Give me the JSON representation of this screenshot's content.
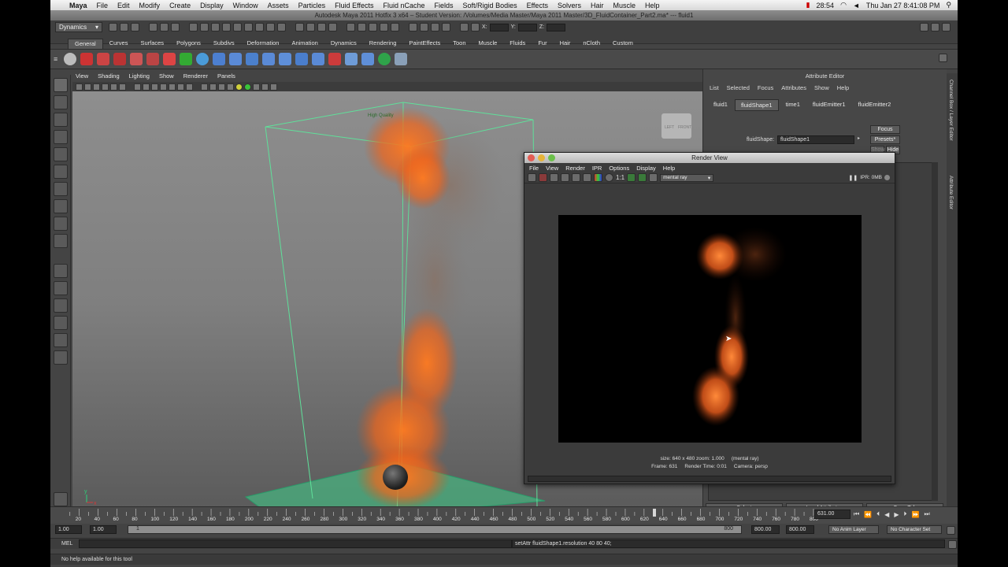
{
  "mac_menubar": {
    "items": [
      "Maya",
      "File",
      "Edit",
      "Modify",
      "Create",
      "Display",
      "Window",
      "Assets",
      "Particles",
      "Fluid Effects",
      "Fluid nCache",
      "Fields",
      "Soft/Rigid Bodies",
      "Effects",
      "Solvers",
      "Hair",
      "Muscle",
      "Help"
    ],
    "battery_time": "28:54",
    "clock": "Thu Jan 27  8:41:08 PM"
  },
  "window_title": "Autodesk Maya 2011 Hotfix 3 x64 – Student Version: /Volumes/Media Master/Maya 2011 Master/3D_FluidContainer_Part2.ma*  ---  fluid1",
  "status_line": {
    "menu_set": "Dynamics",
    "x_label": "X:",
    "y_label": "Y:",
    "z_label": "Z:"
  },
  "shelf_tabs": [
    "General",
    "Curves",
    "Surfaces",
    "Polygons",
    "Subdivs",
    "Deformation",
    "Animation",
    "Dynamics",
    "Rendering",
    "PaintEffects",
    "Toon",
    "Muscle",
    "Fluids",
    "Fur",
    "Hair",
    "nCloth",
    "Custom"
  ],
  "viewport": {
    "menu": [
      "View",
      "Shading",
      "Lighting",
      "Show",
      "Renderer",
      "Panels"
    ],
    "quality_label": "High Quality",
    "viewcube_left": "LEFT",
    "viewcube_front": "FRONT",
    "axis_y": "y",
    "axis_x": "x"
  },
  "attribute_editor": {
    "title": "Attribute Editor",
    "menu": [
      "List",
      "Selected",
      "Focus",
      "Attributes",
      "Show",
      "Help"
    ],
    "tabs": [
      "fluid1",
      "fluidShape1",
      "time1",
      "fluidEmitter1",
      "fluidEmitter2"
    ],
    "shape_label": "fluidShape:",
    "shape_value": "fluidShape1",
    "focus_btn": "Focus",
    "presets_btn": "Presets*",
    "show_btn": "Show",
    "hide_btn": "Hide",
    "bottom_buttons": [
      "Select",
      "Load Attributes",
      "Copy Tab"
    ],
    "side_tab_1": "Channel Box / Layer Editor",
    "side_tab_2": "Attribute Editor"
  },
  "render_view": {
    "title": "Render View",
    "menu": [
      "File",
      "View",
      "Render",
      "IPR",
      "Options",
      "Display",
      "Help"
    ],
    "ratio_label": "1:1",
    "renderer": "mental ray",
    "ipr_status": "IPR: 0MB",
    "info_size": "size: 640 x 480  zoom: 1.000",
    "info_renderer": "(mental ray)",
    "info_frame": "Frame: 631",
    "info_time": "Render Time: 0:01",
    "info_camera": "Camera: persp"
  },
  "timeline": {
    "ticks": [
      "20",
      "40",
      "60",
      "80",
      "100",
      "120",
      "140",
      "160",
      "180",
      "200",
      "220",
      "240",
      "260",
      "280",
      "300",
      "320",
      "340",
      "360",
      "380",
      "400",
      "420",
      "440",
      "460",
      "480",
      "500",
      "520",
      "540",
      "560",
      "580",
      "600",
      "620",
      "640",
      "660",
      "680",
      "700",
      "720",
      "740",
      "760",
      "780",
      "800"
    ],
    "current_frame": "631.00",
    "playhead_value": 631,
    "range_min": 1,
    "range_max": 800
  },
  "range_bar": {
    "start": "1.00",
    "playback_start": "1.00",
    "range_marker": "1",
    "range_end_marker": "800",
    "playback_end": "800.00",
    "end": "800.00",
    "anim_layer": "No Anim Layer",
    "character_set": "No Character Set"
  },
  "command_line": {
    "lang": "MEL",
    "result": "setAttr fluidShape1.resolution 40 80 40;"
  },
  "help_line": "No help available for this tool"
}
